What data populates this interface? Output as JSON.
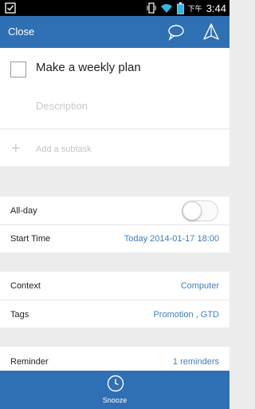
{
  "status_bar": {
    "time": "3:44",
    "ampm": "下午",
    "icons": [
      "checkbox-notification-icon",
      "vibrate-icon",
      "wifi-icon",
      "battery-icon"
    ]
  },
  "app_bar": {
    "close_label": "Close",
    "icons": [
      "comment-icon",
      "share-icon"
    ]
  },
  "task": {
    "title": "Make a weekly plan",
    "description_placeholder": "Description",
    "add_subtask_label": "Add a subtask",
    "completed": false
  },
  "details": {
    "all_day": {
      "label": "All-day",
      "on": false
    },
    "start_time": {
      "label": "Start Time",
      "value": "Today 2014-01-17 18:00"
    },
    "context": {
      "label": "Context",
      "value": "Computer"
    },
    "tags": {
      "label": "Tags",
      "value": "Promotion , GTD"
    },
    "reminder": {
      "label": "Reminder",
      "value": "1 reminders"
    }
  },
  "bottom_bar": {
    "snooze_label": "Snooze"
  },
  "colors": {
    "primary": "#2f6fb3",
    "link": "#3d7fbc",
    "background": "#ececec"
  }
}
